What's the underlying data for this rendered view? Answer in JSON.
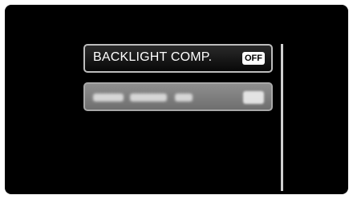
{
  "menu": {
    "items": [
      {
        "label": "BACKLIGHT COMP.",
        "value": "OFF",
        "selected": true
      },
      {
        "label": "",
        "value": "",
        "selected": false,
        "obscured": true
      }
    ]
  },
  "colors": {
    "background": "#000000",
    "item_border": "#bdbdbd",
    "obscured_item": "#7f7f7f"
  }
}
